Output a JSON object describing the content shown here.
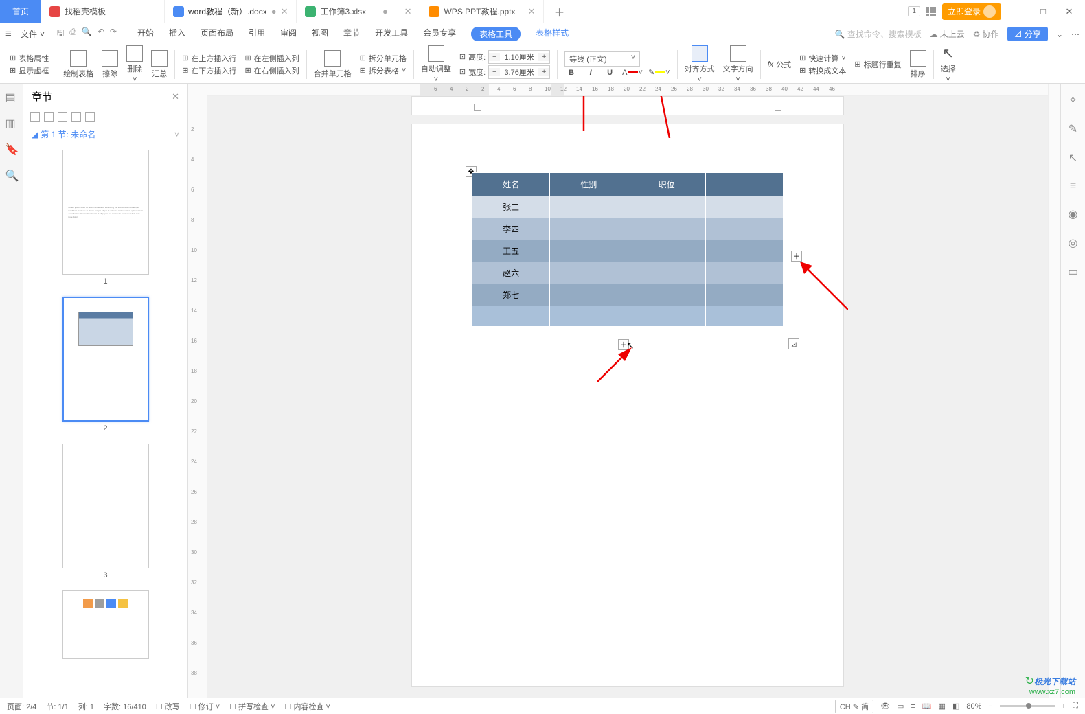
{
  "titlebar": {
    "home": "首页",
    "tabs": [
      {
        "label": "找稻壳模板",
        "icon_bg": "#e64544"
      },
      {
        "label": "word教程（新）.docx",
        "icon_bg": "#4b8bf4",
        "active": true
      },
      {
        "label": "工作簿3.xlsx",
        "icon_bg": "#3cb371"
      },
      {
        "label": "WPS PPT教程.pptx",
        "icon_bg": "#ff8c00"
      }
    ],
    "tab_count": "1",
    "login": "立即登录",
    "win_min": "—",
    "win_max": "□",
    "win_close": "✕"
  },
  "menubar": {
    "file": "文件",
    "tabs": [
      "开始",
      "插入",
      "页面布局",
      "引用",
      "审阅",
      "视图",
      "章节",
      "开发工具",
      "会员专享"
    ],
    "table_tools": "表格工具",
    "table_style": "表格样式",
    "search_placeholder": "查找命令、搜索模板",
    "not_cloud": "未上云",
    "coop": "协作",
    "share": "分享"
  },
  "ribbon": {
    "table_props": "表格属性",
    "show_grid": "显示虚框",
    "draw_table": "绘制表格",
    "erase": "擦除",
    "delete": "删除",
    "summary": "汇总",
    "ins_above": "在上方插入行",
    "ins_left": "在左侧插入列",
    "ins_below": "在下方插入行",
    "ins_right": "在右侧插入列",
    "merge": "合并单元格",
    "split_cell": "拆分单元格",
    "split_table": "拆分表格",
    "auto_adjust": "自动调整",
    "height_label": "高度:",
    "height_val": "1.10厘米",
    "width_label": "宽度:",
    "width_val": "3.76厘米",
    "font_name": "等线 (正文)",
    "align": "对齐方式",
    "text_dir": "文字方向",
    "formula": "公式",
    "quick_calc": "快速计算",
    "title_repeat": "标题行重复",
    "to_text": "转换成文本",
    "sort": "排序",
    "select": "选择"
  },
  "chapter": {
    "title": "章节",
    "section1": "第 1 节: 未命名",
    "pages": [
      "1",
      "2",
      "3"
    ]
  },
  "table": {
    "headers": [
      "姓名",
      "性别",
      "职位"
    ],
    "rows": [
      "张三",
      "李四",
      "王五",
      "赵六",
      "郑七"
    ]
  },
  "statusbar": {
    "page": "页面: 2/4",
    "section": "节: 1/1",
    "col": "列: 1",
    "words": "字数: 16/410",
    "track": "改写",
    "revise": "修订",
    "spell": "拼写检查",
    "content": "内容检查",
    "ime": "CH ✎ 简",
    "zoom": "80%"
  },
  "watermark": {
    "line1": "极光下载站",
    "line2": "www.xz7.com"
  }
}
